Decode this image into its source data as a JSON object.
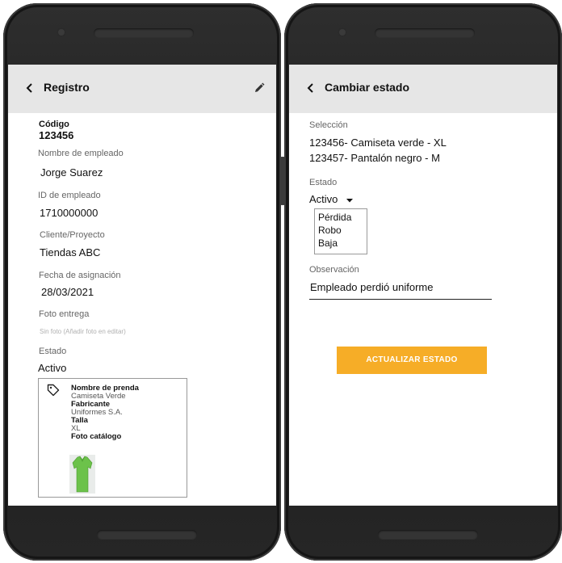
{
  "left_screen": {
    "header": {
      "title": "Registro",
      "back_icon": "chevron-left-icon",
      "edit_icon": "pencil-icon"
    },
    "fields": {
      "codigo_label": "Código",
      "codigo_value": "123456",
      "nombre_label": "Nombre de empleado",
      "nombre_value": "Jorge Suarez",
      "id_label": "ID de empleado",
      "id_value": "1710000000",
      "cliente_label": "Cliente/Proyecto",
      "cliente_value": "Tiendas ABC",
      "fecha_label": "Fecha de asignación",
      "fecha_value": "28/03/2021",
      "foto_label": "Foto entrega",
      "foto_value": "Sin foto (Añadir foto en editar)",
      "estado_label": "Estado",
      "estado_value": "Activo"
    },
    "garment_card": {
      "icon": "tag-icon",
      "nombre_label": "Nombre de prenda",
      "nombre_value": "Camiseta Verde",
      "fabricante_label": "Fabricante",
      "fabricante_value": "Uniformes S.A.",
      "talla_label": "Talla",
      "talla_value": "XL",
      "foto_label": "Foto catálogo",
      "image": "green-polo-shirt"
    }
  },
  "right_screen": {
    "header": {
      "title": "Cambiar estado",
      "back_icon": "chevron-left-icon"
    },
    "seleccion_label": "Selección",
    "selection_items": [
      {
        "code": "123456-",
        "desc": " Camiseta verde - XL"
      },
      {
        "code": "123457-",
        "desc": " Pantalón negro - M"
      }
    ],
    "estado_label": "Estado",
    "estado_selected": "Activo",
    "estado_options": [
      "Pérdida",
      "Robo",
      "Baja"
    ],
    "observacion_label": "Observación",
    "observacion_value": "Empleado perdió uniforme",
    "submit_label": "ACTUALIZAR ESTADO"
  },
  "colors": {
    "appbar_bg": "#e6e6e6",
    "accent_button": "#f6ad27",
    "shirt_green": "#6cc24a",
    "phone_body": "#222222"
  }
}
